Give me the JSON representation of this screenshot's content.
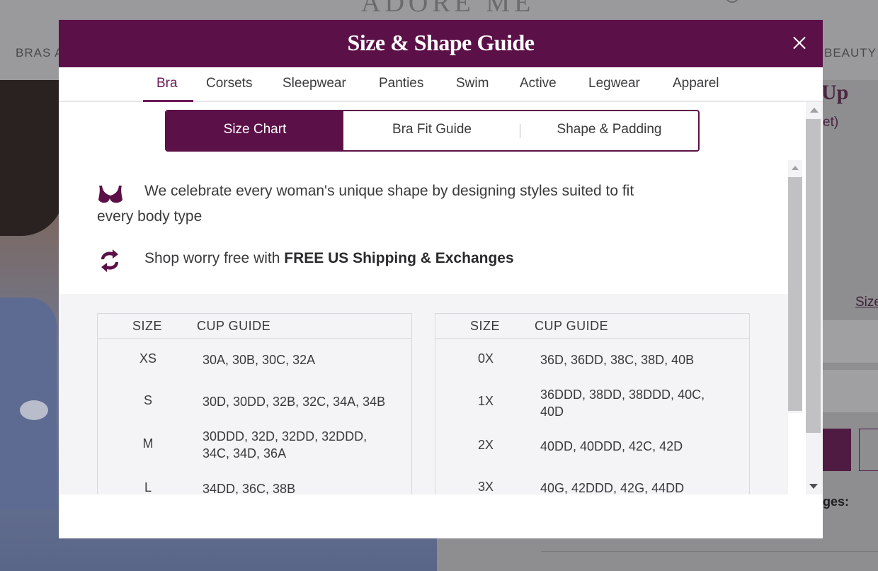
{
  "background": {
    "logo": "ADORE ME",
    "nav_left": "BRAS A",
    "nav_right": "BEAUTY",
    "title_peek": "Up",
    "link_peek": "et)",
    "size_link": "Size",
    "ges_text": "ges:"
  },
  "modal": {
    "title": "Size & Shape Guide",
    "close_label": "×",
    "category_tabs": [
      "Bra",
      "Corsets",
      "Sleepwear",
      "Panties",
      "Swim",
      "Active",
      "Legwear",
      "Apparel"
    ],
    "active_category": "Bra",
    "sub_tabs": [
      "Size Chart",
      "Bra Fit Guide",
      "Shape & Padding"
    ],
    "active_sub_tab": "Size Chart",
    "info": {
      "celebrate_line1": "We celebrate every woman's unique shape by designing styles suited to fit",
      "celebrate_line2": "every body type",
      "shipping_prefix": "Shop worry free with ",
      "shipping_bold": "FREE US Shipping & Exchanges"
    },
    "icons": {
      "bra": "bra-icon",
      "exchange": "exchange-arrows-icon",
      "close": "close-icon"
    },
    "tables": [
      {
        "headers": {
          "size": "SIZE",
          "cup": "CUP GUIDE"
        },
        "rows": [
          {
            "size": "XS",
            "cup": "30A, 30B, 30C, 32A"
          },
          {
            "size": "S",
            "cup": "30D, 30DD, 32B, 32C, 34A, 34B"
          },
          {
            "size": "M",
            "cup_line1": "30DDD, 32D, 32DD, 32DDD,",
            "cup_line2": "34C, 34D, 36A"
          },
          {
            "size": "L",
            "cup": "34DD, 36C, 38B"
          }
        ]
      },
      {
        "headers": {
          "size": "SIZE",
          "cup": "CUP GUIDE"
        },
        "rows": [
          {
            "size": "0X",
            "cup": "36D, 36DD, 38C, 38D, 40B"
          },
          {
            "size": "1X",
            "cup_line1": "36DDD, 38DD, 38DDD, 40C,",
            "cup_line2": "40D"
          },
          {
            "size": "2X",
            "cup": "40DD, 40DDD, 42C, 42D"
          },
          {
            "size": "3X",
            "cup": "40G, 42DDD, 42G, 44DD"
          }
        ]
      }
    ],
    "colors": {
      "brand_purple": "#5b1148",
      "active_tab": "#6b1a56",
      "table_bg": "#f4f4f7"
    }
  }
}
